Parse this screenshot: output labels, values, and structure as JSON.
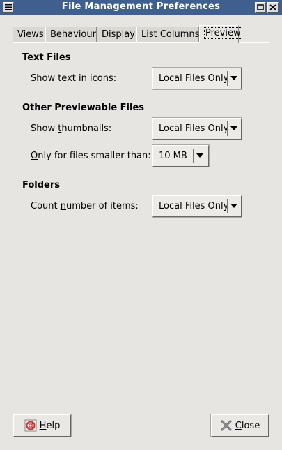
{
  "window": {
    "title": "File Management Preferences",
    "menu_icon": "window-menu-icon",
    "minimize_icon": "minimize-icon",
    "close_icon": "close-icon"
  },
  "tabs": [
    {
      "label": "Views"
    },
    {
      "label": "Behaviour"
    },
    {
      "label": "Display"
    },
    {
      "label": "List Columns"
    },
    {
      "label": "Preview",
      "active": true
    }
  ],
  "sections": {
    "text_files": {
      "heading": "Text Files",
      "label_pre": "Show te",
      "label_mnemonic": "x",
      "label_post": "t in icons:",
      "value": "Local Files Only"
    },
    "other": {
      "heading": "Other Previewable Files",
      "thumb_label_pre": "Show ",
      "thumb_label_mnemonic": "t",
      "thumb_label_post": "humbnails:",
      "thumb_value": "Local Files Only",
      "size_label_mnemonic": "O",
      "size_label_post": "nly for files smaller than:",
      "size_value": "10 MB"
    },
    "folders": {
      "heading": "Folders",
      "label_pre": "Count ",
      "label_mnemonic": "n",
      "label_post": "umber of items:",
      "value": "Local Files Only"
    }
  },
  "buttons": {
    "help_mnemonic": "H",
    "help_rest": "elp",
    "close_mnemonic": "C",
    "close_rest": "lose",
    "help_icon": "help-lifebuoy-icon",
    "close_icon": "close-x-icon"
  },
  "colors": {
    "titlebar": "#3f5f8f",
    "background": "#e6e5e1"
  }
}
